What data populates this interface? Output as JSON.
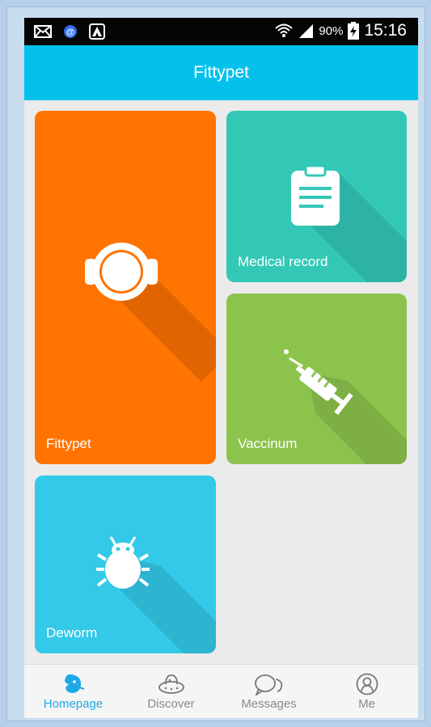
{
  "statusbar": {
    "battery": "90%",
    "time": "15:16"
  },
  "appbar": {
    "title": "Fittypet"
  },
  "tiles": [
    {
      "label": "Fittypet",
      "icon": "device-ring-icon",
      "color": "#ff7300"
    },
    {
      "label": "Medical record",
      "icon": "clipboard-icon",
      "color": "#33c8b6"
    },
    {
      "label": "Vaccinum",
      "icon": "syringe-icon",
      "color": "#8cc34d"
    },
    {
      "label": "Deworm",
      "icon": "bug-icon",
      "color": "#33c9e8"
    }
  ],
  "nav": [
    {
      "label": "Homepage",
      "icon": "dog-icon",
      "active": true
    },
    {
      "label": "Discover",
      "icon": "ufo-icon",
      "active": false
    },
    {
      "label": "Messages",
      "icon": "chat-icon",
      "active": false
    },
    {
      "label": "Me",
      "icon": "user-icon",
      "active": false
    }
  ],
  "colors": {
    "accent": "#04c1ec",
    "nav_active": "#1ea9e6",
    "nav_inactive": "#8a8a8a"
  }
}
